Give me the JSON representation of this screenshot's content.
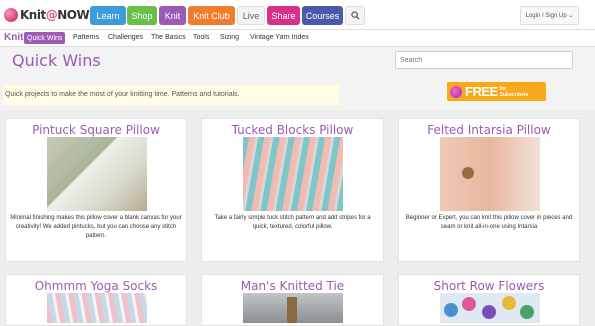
{
  "header": {
    "logo": {
      "text_before": "Knit",
      "at": "@",
      "text_after": "NOW"
    },
    "nav": [
      {
        "label": "Learn",
        "color": "#3d9bdc"
      },
      {
        "label": "Shop",
        "color": "#6abf4b"
      },
      {
        "label": "Knit",
        "color": "#9b5bb4"
      },
      {
        "label": "Knit Club",
        "color": "#f07d2c"
      },
      {
        "label": "Live",
        "color": "#f4f4f4"
      },
      {
        "label": "Share",
        "color": "#d8308a"
      },
      {
        "label": "Courses",
        "color": "#4a5aa8"
      }
    ],
    "search_icon": "search-icon",
    "login_label": "Login / Sign Up ⌄"
  },
  "subnav": {
    "brand": "Knit",
    "items": [
      "Quick Wins",
      "Patterns",
      "Challenges",
      "The Basics",
      "Tools",
      "Sizing",
      "Vintage Yarn Index"
    ]
  },
  "page": {
    "title": "Quick Wins",
    "search_placeholder": "Search",
    "intro": "Quick projects to make the most of your knitting time. Patterns and tutorials.",
    "promo": {
      "free": "FREE",
      "for": "for",
      "subscribers": "Subscribers"
    }
  },
  "cards": [
    {
      "title": "Pintuck Square Pillow",
      "desc": "Minimal finishing makes this pillow cover a blank canvas for your creativity! We added pintucks, but you can choose any stitch pattern."
    },
    {
      "title": "Tucked Blocks Pillow",
      "desc": "Take a fairly simple tuck stitch pattern and add stripes for a quick, textured, colorful pillow."
    },
    {
      "title": "Felted Intarsia Pillow",
      "desc": "Beginner or Expert, you can knit this pillow cover in pieces and seam or knit all-in-one using Intarsia"
    },
    {
      "title": "Ohmmm Yoga Socks",
      "desc": ""
    },
    {
      "title": "Man's Knitted Tie",
      "desc": ""
    },
    {
      "title": "Short Row Flowers",
      "desc": ""
    }
  ]
}
